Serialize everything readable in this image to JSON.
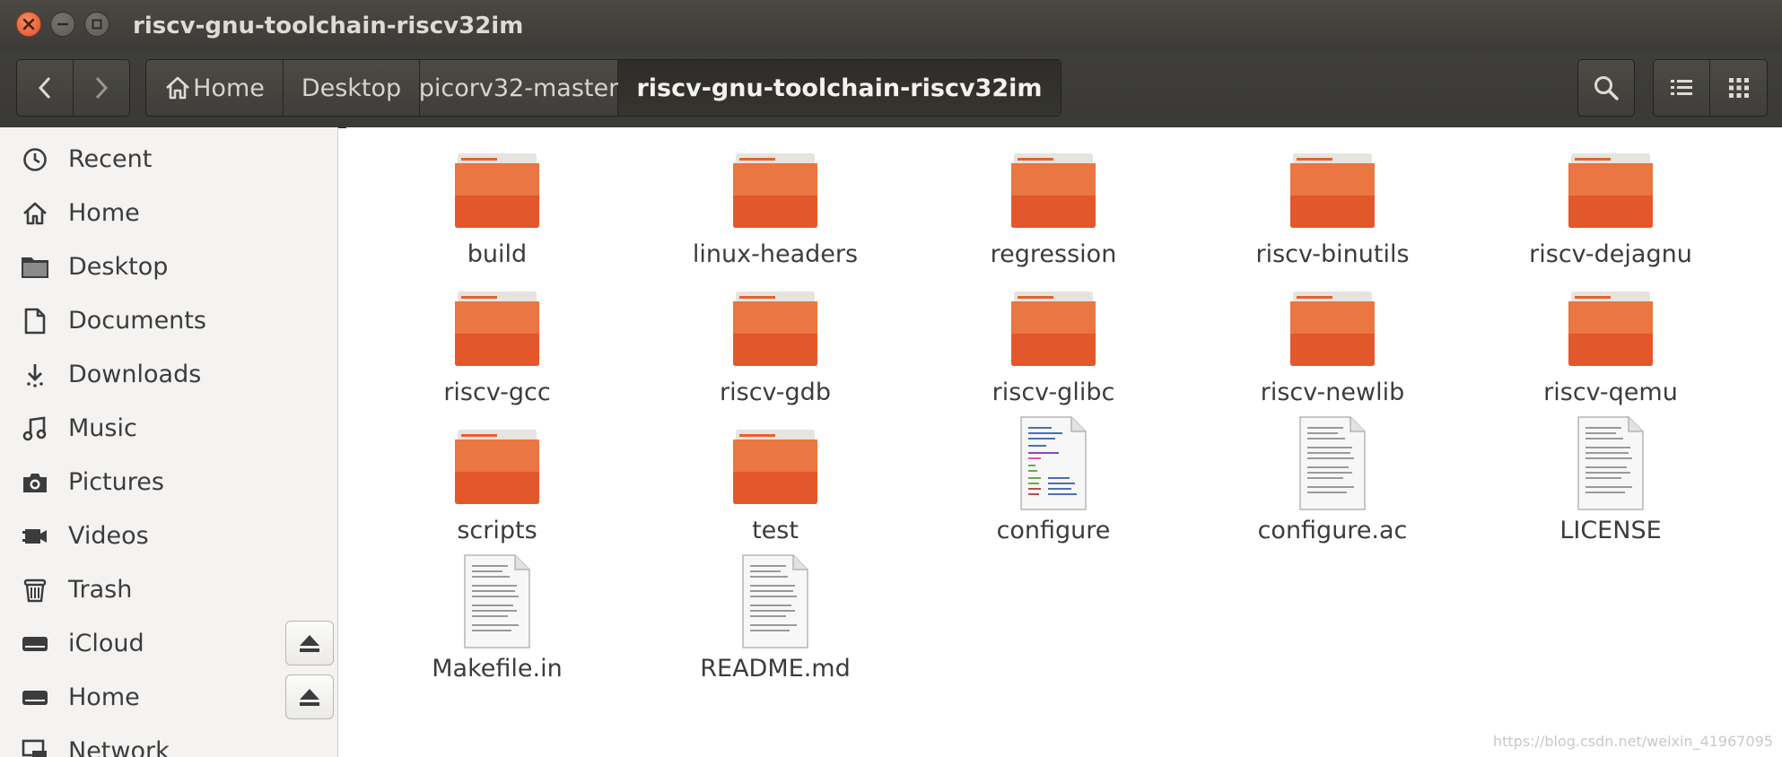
{
  "window": {
    "title": "riscv-gnu-toolchain-riscv32im",
    "controls": [
      "close-icon",
      "minimize-icon",
      "maximize-icon"
    ]
  },
  "toolbar": {
    "back_icon": "chevron-left-icon",
    "forward_icon": "chevron-right-icon",
    "breadcrumbs": [
      {
        "label": "Home",
        "icon": "home-icon"
      },
      {
        "label": "Desktop"
      },
      {
        "label": "picorv32-master"
      },
      {
        "label": "riscv-gnu-toolchain-riscv32im",
        "active": true
      }
    ],
    "search_icon": "search-icon",
    "view_list_icon": "list-view-icon",
    "view_grid_icon": "grid-view-icon"
  },
  "sidebar": {
    "items": [
      {
        "label": "Recent",
        "icon": "clock-icon"
      },
      {
        "label": "Home",
        "icon": "home-icon"
      },
      {
        "label": "Desktop",
        "icon": "folder-icon"
      },
      {
        "label": "Documents",
        "icon": "document-icon"
      },
      {
        "label": "Downloads",
        "icon": "download-icon"
      },
      {
        "label": "Music",
        "icon": "music-icon"
      },
      {
        "label": "Pictures",
        "icon": "camera-icon"
      },
      {
        "label": "Videos",
        "icon": "video-icon"
      },
      {
        "label": "Trash",
        "icon": "trash-icon"
      },
      {
        "label": "iCloud",
        "icon": "drive-icon",
        "eject": true
      },
      {
        "label": "Home",
        "icon": "drive-icon",
        "eject": true
      },
      {
        "label": "Network",
        "icon": "network-icon"
      }
    ]
  },
  "files": [
    {
      "name": "build",
      "type": "folder"
    },
    {
      "name": "linux-headers",
      "type": "folder"
    },
    {
      "name": "regression",
      "type": "folder"
    },
    {
      "name": "riscv-binutils",
      "type": "folder"
    },
    {
      "name": "riscv-dejagnu",
      "type": "folder"
    },
    {
      "name": "riscv-gcc",
      "type": "folder"
    },
    {
      "name": "riscv-gdb",
      "type": "folder"
    },
    {
      "name": "riscv-glibc",
      "type": "folder"
    },
    {
      "name": "riscv-newlib",
      "type": "folder"
    },
    {
      "name": "riscv-qemu",
      "type": "folder"
    },
    {
      "name": "scripts",
      "type": "folder"
    },
    {
      "name": "test",
      "type": "folder"
    },
    {
      "name": "configure",
      "type": "script"
    },
    {
      "name": "configure.ac",
      "type": "text"
    },
    {
      "name": "LICENSE",
      "type": "text"
    },
    {
      "name": "Makefile.in",
      "type": "text"
    },
    {
      "name": "README.md",
      "type": "text"
    }
  ],
  "watermark": "https://blog.csdn.net/weixin_41967095",
  "colors": {
    "titlebar": "#3c3b37",
    "close_button": "#e1552a",
    "folder": "#e8602c",
    "sidebar_bg": "#f4f3f2"
  }
}
